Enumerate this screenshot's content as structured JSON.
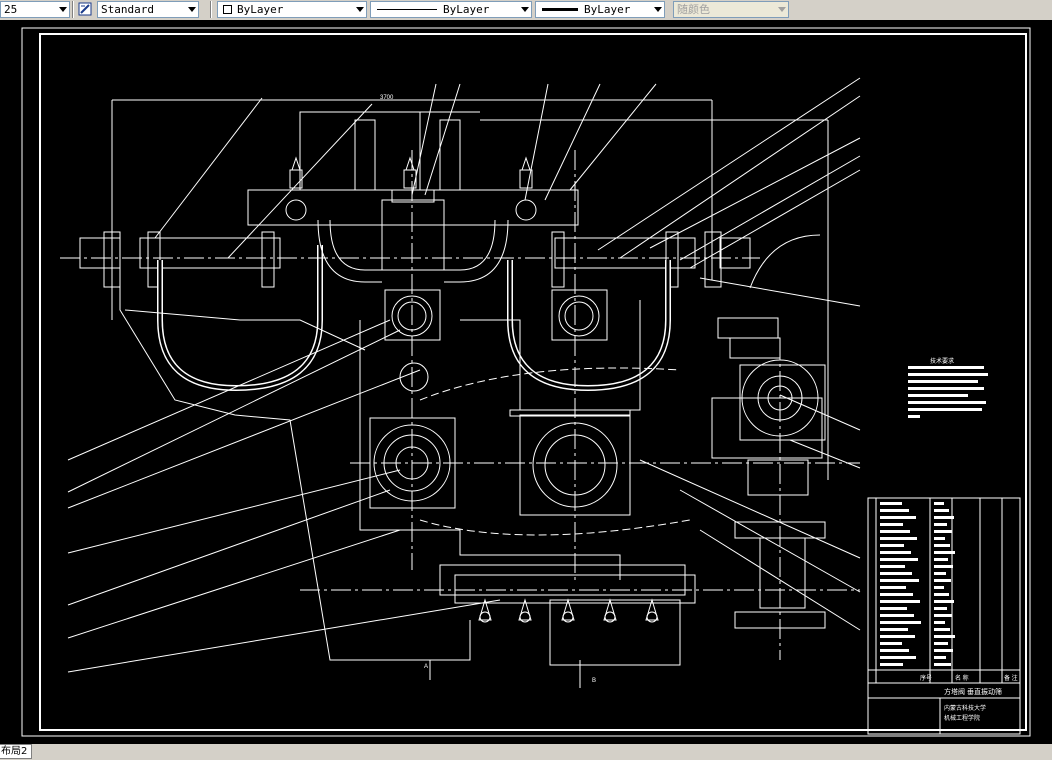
{
  "toolbar": {
    "scale_value": "25",
    "text_style": "Standard",
    "layer": "ByLayer",
    "linetype": "ByLayer",
    "lineweight": "ByLayer",
    "color": "随颜色"
  },
  "layout_tab": "布局2",
  "drawing": {
    "title_block_name": "方塔阀 垂直振动筛",
    "title_block_org": "内蒙古科技大学",
    "title_block_dept": "机械工程学院",
    "table_header": [
      "序号",
      "名 称",
      "备 注"
    ],
    "tech_req_title": "技术要求",
    "dim_1": "3700",
    "dim_2": "A",
    "dim_3": "B"
  },
  "colors": {
    "canvas": "#000000",
    "lines": "#ffffff",
    "toolbar": "#d4d0c8"
  }
}
